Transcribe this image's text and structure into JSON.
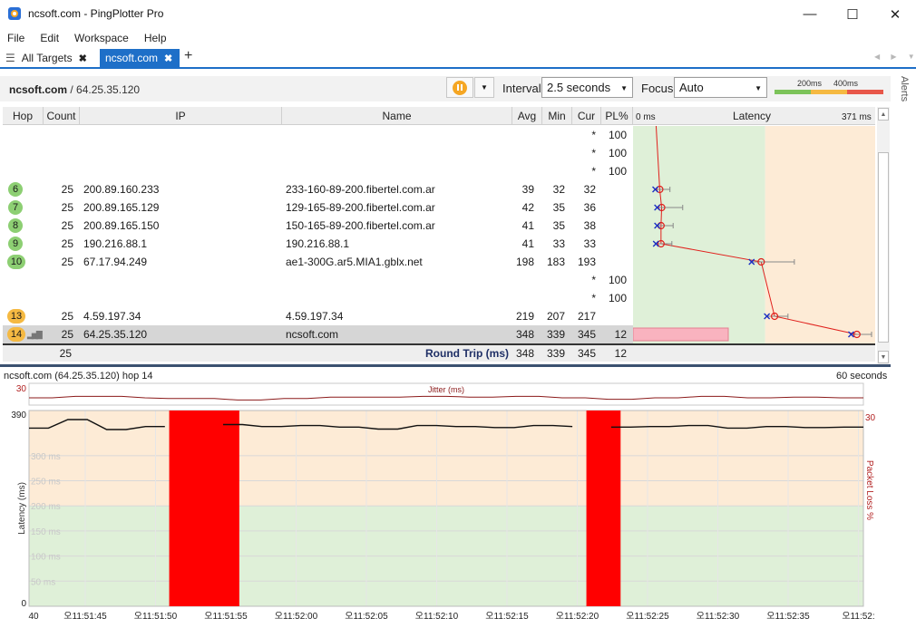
{
  "window": {
    "title": "ncsoft.com - PingPlotter Pro",
    "controls": [
      "—",
      "☐",
      "✕"
    ]
  },
  "menu": [
    "File",
    "Edit",
    "Workspace",
    "Help"
  ],
  "tabs": {
    "all_targets": "All Targets",
    "current": "ncsoft.com",
    "add": "+",
    "close": "✖"
  },
  "toolbar": {
    "target_host": "ncsoft.com",
    "target_ip": " / 64.25.35.120",
    "interval_label": "Interval",
    "interval_value": "2.5 seconds",
    "focus_label": "Focus",
    "focus_value": "Auto",
    "legend_200": "200ms",
    "legend_400": "400ms",
    "legend_colors": [
      "#7cc35a",
      "#f5b942",
      "#e8574a"
    ],
    "alerts": "Alerts"
  },
  "table": {
    "headers": {
      "hop": "Hop",
      "count": "Count",
      "ip": "IP",
      "name": "Name",
      "avg": "Avg",
      "min": "Min",
      "cur": "Cur",
      "pl": "PL%",
      "latency": "Latency",
      "lat_min": "0 ms",
      "lat_max": "371 ms"
    },
    "rows": [
      {
        "hop": "",
        "count": "",
        "ip": "",
        "name": "",
        "avg": "",
        "min": "",
        "cur": "*",
        "pl": "100",
        "color": ""
      },
      {
        "hop": "",
        "count": "",
        "ip": "",
        "name": "",
        "avg": "",
        "min": "",
        "cur": "*",
        "pl": "100",
        "color": ""
      },
      {
        "hop": "",
        "count": "",
        "ip": "",
        "name": "",
        "avg": "",
        "min": "",
        "cur": "*",
        "pl": "100",
        "color": ""
      },
      {
        "hop": "6",
        "count": "25",
        "ip": "200.89.160.233",
        "name": "233-160-89-200.fibertel.com.ar",
        "avg": "39",
        "min": "32",
        "cur": "32",
        "pl": "",
        "color": "#8dcf73"
      },
      {
        "hop": "7",
        "count": "25",
        "ip": "200.89.165.129",
        "name": "129-165-89-200.fibertel.com.ar",
        "avg": "42",
        "min": "35",
        "cur": "36",
        "pl": "",
        "color": "#8dcf73"
      },
      {
        "hop": "8",
        "count": "25",
        "ip": "200.89.165.150",
        "name": "150-165-89-200.fibertel.com.ar",
        "avg": "41",
        "min": "35",
        "cur": "38",
        "pl": "",
        "color": "#8dcf73"
      },
      {
        "hop": "9",
        "count": "25",
        "ip": "190.216.88.1",
        "name": "190.216.88.1",
        "avg": "41",
        "min": "33",
        "cur": "33",
        "pl": "",
        "color": "#8dcf73"
      },
      {
        "hop": "10",
        "count": "25",
        "ip": "67.17.94.249",
        "name": "ae1-300G.ar5.MIA1.gblx.net",
        "avg": "198",
        "min": "183",
        "cur": "193",
        "pl": "",
        "color": "#8dcf73"
      },
      {
        "hop": "",
        "count": "",
        "ip": "",
        "name": "",
        "avg": "",
        "min": "",
        "cur": "*",
        "pl": "100",
        "color": ""
      },
      {
        "hop": "",
        "count": "",
        "ip": "",
        "name": "",
        "avg": "",
        "min": "",
        "cur": "*",
        "pl": "100",
        "color": ""
      },
      {
        "hop": "13",
        "count": "25",
        "ip": "4.59.197.34",
        "name": "4.59.197.34",
        "avg": "219",
        "min": "207",
        "cur": "217",
        "pl": "",
        "color": "#f5b942"
      },
      {
        "hop": "14",
        "count": "25",
        "ip": "64.25.35.120",
        "name": "ncsoft.com",
        "avg": "348",
        "min": "339",
        "cur": "345",
        "pl": "12",
        "color": "#f5b942"
      }
    ],
    "round_trip": {
      "count": "25",
      "label": "Round Trip (ms)",
      "avg": "348",
      "min": "339",
      "cur": "345",
      "pl": "12"
    }
  },
  "latency_plot": {
    "max_ms": 371,
    "hop_rows": [
      3,
      4,
      5,
      6,
      7,
      10,
      11
    ],
    "avg": [
      39,
      42,
      41,
      41,
      198,
      219,
      348
    ],
    "min": [
      32,
      35,
      35,
      33,
      183,
      207,
      339
    ],
    "err_max": [
      55,
      75,
      60,
      58,
      250,
      240,
      371
    ],
    "loss_pct_last": 12,
    "zone_boundary_ms": 200,
    "colors": {
      "line": "#e0201c",
      "min": "#1b2fc4",
      "green": "#dff0d8",
      "orange": "#fdebd6",
      "loss": "#f9b3bf"
    }
  },
  "timegraph": {
    "title": "ncsoft.com (64.25.35.120) hop 14",
    "duration": "60 seconds",
    "jitter_label": "Jitter (ms)",
    "jitter_max": "30",
    "lat_axis_label": "Latency (ms)",
    "loss_axis_label": "Packet Loss %",
    "y_max_label": "390",
    "y_min_label": "0",
    "loss_max_label": "30",
    "gridlines": [
      "300 ms",
      "250 ms",
      "200 ms",
      "150 ms",
      "100 ms",
      "50 ms"
    ],
    "grid_values": [
      300,
      250,
      200,
      150,
      100,
      50
    ],
    "x_first_label": "40",
    "x_labels": [
      "오11:51:45",
      "오11:51:50",
      "오11:51:55",
      "오11:52:00",
      "오11:52:05",
      "오11:52:10",
      "오11:52:15",
      "오11:52:20",
      "오11:52:25",
      "오11:52:30",
      "오11:52:35",
      "오11:52:"
    ],
    "loss_spans": [
      [
        0.168,
        0.252
      ],
      [
        0.668,
        0.709
      ]
    ],
    "latency_series": [
      355,
      355,
      372,
      372,
      352,
      352,
      358,
      358,
      358,
      358,
      362,
      362,
      358,
      358,
      360,
      360,
      357,
      357,
      353,
      353,
      360,
      360,
      358,
      358,
      356,
      356,
      360,
      360,
      358,
      358,
      357,
      357,
      358,
      358,
      360,
      360,
      355,
      355,
      358,
      358,
      356,
      356,
      357,
      357
    ],
    "jitter_series": [
      10,
      10,
      12,
      12,
      12,
      10,
      9,
      9,
      9,
      7,
      7,
      9,
      9,
      11,
      11,
      11,
      11,
      12,
      12,
      11,
      11,
      12,
      12,
      10,
      10,
      8,
      8,
      10,
      10,
      12,
      12,
      10,
      10,
      11,
      11,
      10,
      10
    ],
    "colors": {
      "orange": "#fdebd6",
      "green": "#dff0d8",
      "loss": "#ff0000",
      "jitter": "#8b1a1a",
      "axis_red": "#b22222"
    }
  }
}
